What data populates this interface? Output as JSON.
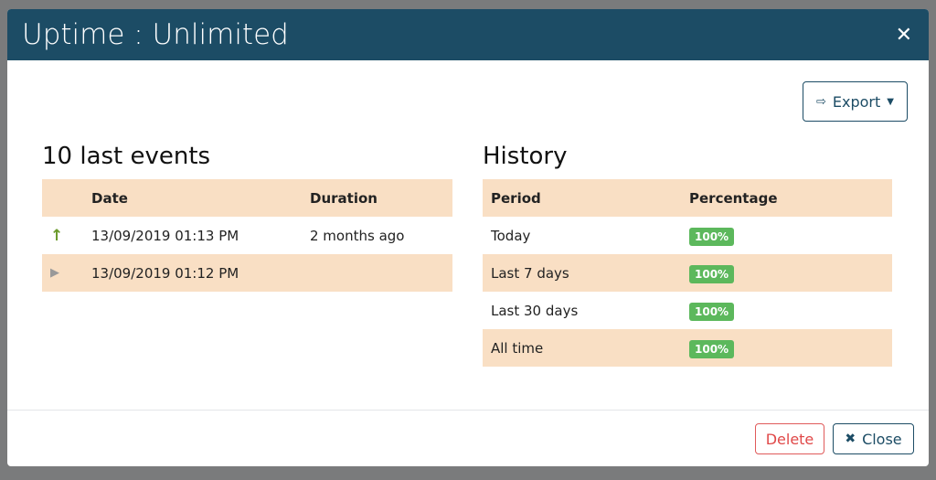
{
  "modal": {
    "title": "Uptime : Unlimited",
    "close_icon": "close-icon"
  },
  "toolbar": {
    "export_label": "Export"
  },
  "events": {
    "title": "10 last events",
    "headers": [
      "",
      "Date",
      "Duration"
    ],
    "rows": [
      {
        "icon": "arrow-up-icon",
        "icon_color": "#6a9a2a",
        "date": "13/09/2019 01:13 PM",
        "duration": "2 months ago"
      },
      {
        "icon": "play-icon",
        "icon_color": "#999999",
        "date": "13/09/2019 01:12 PM",
        "duration": ""
      }
    ]
  },
  "history": {
    "title": "History",
    "headers": [
      "Period",
      "Percentage"
    ],
    "rows": [
      {
        "period": "Today",
        "pct": "100%"
      },
      {
        "period": "Last 7 days",
        "pct": "100%"
      },
      {
        "period": "Last 30 days",
        "pct": "100%"
      },
      {
        "period": "All time",
        "pct": "100%"
      }
    ]
  },
  "footer": {
    "delete_label": "Delete",
    "close_label": "Close"
  },
  "colors": {
    "header": "#1c4c65",
    "row_alt": "#f9dfc4",
    "badge": "#5cb85c",
    "danger": "#e04848"
  }
}
